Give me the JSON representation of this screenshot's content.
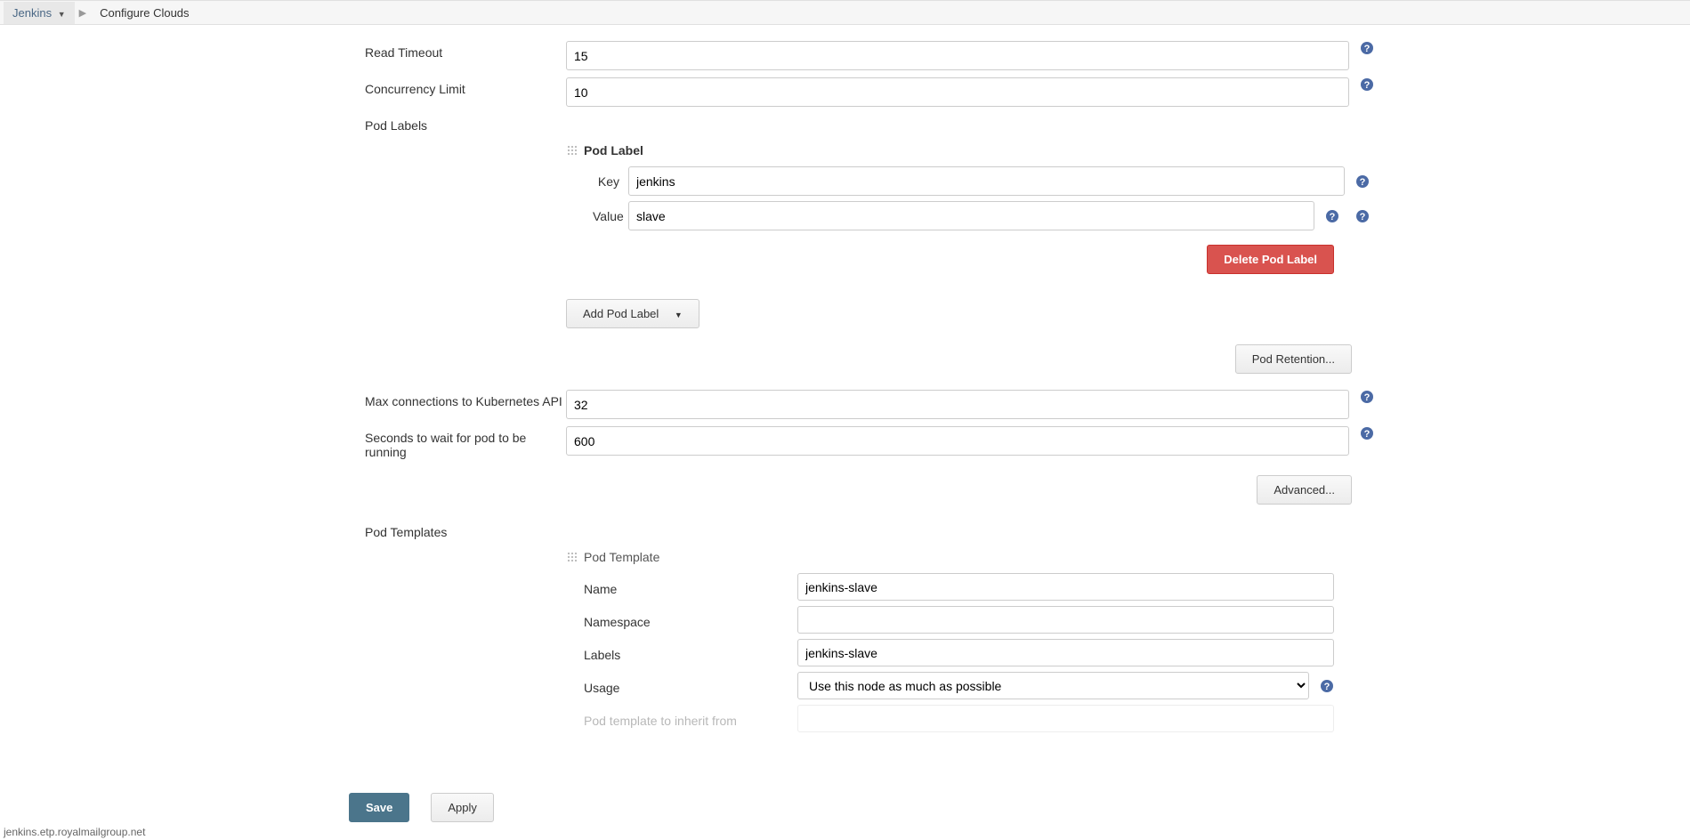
{
  "breadcrumb": {
    "root": "Jenkins",
    "current": "Configure Clouds"
  },
  "fields": {
    "readTimeout": {
      "label": "Read Timeout",
      "value": "15"
    },
    "concurrencyLimit": {
      "label": "Concurrency Limit",
      "value": "10"
    },
    "podLabelsLabel": "Pod Labels",
    "podLabelHeader": "Pod Label",
    "podLabelKey": {
      "label": "Key",
      "value": "jenkins"
    },
    "podLabelValue": {
      "label": "Value",
      "value": "slave"
    },
    "deletePodLabel": "Delete Pod Label",
    "addPodLabel": "Add Pod Label",
    "podRetention": "Pod Retention...",
    "maxConn": {
      "label": "Max connections to Kubernetes API",
      "value": "32"
    },
    "waitSeconds": {
      "label": "Seconds to wait for pod to be running",
      "value": "600"
    },
    "advanced": "Advanced...",
    "podTemplatesLabel": "Pod Templates",
    "podTemplateHeader": "Pod Template",
    "tplName": {
      "label": "Name",
      "value": "jenkins-slave"
    },
    "tplNamespace": {
      "label": "Namespace",
      "value": ""
    },
    "tplLabels": {
      "label": "Labels",
      "value": "jenkins-slave"
    },
    "tplUsage": {
      "label": "Usage",
      "value": "Use this node as much as possible"
    },
    "tplInherit": {
      "label": "Pod template to inherit from",
      "value": ""
    }
  },
  "footer": {
    "save": "Save",
    "apply": "Apply",
    "status": "jenkins.etp.royalmailgroup.net"
  }
}
